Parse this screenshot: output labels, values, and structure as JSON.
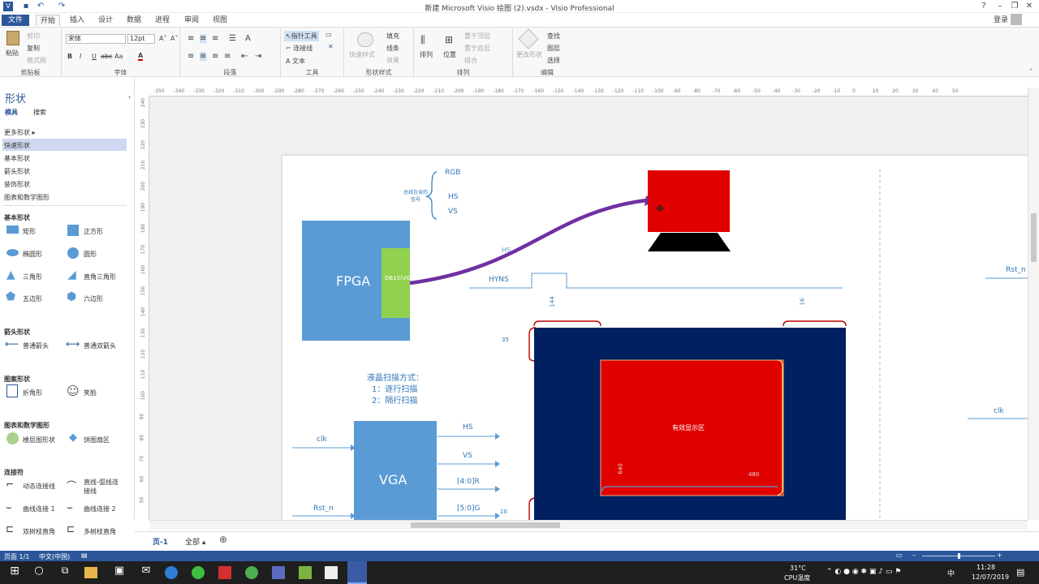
{
  "window": {
    "title": "新建 Microsoft Visio 绘图 (2).vsdx - Visio Professional",
    "help": "?"
  },
  "menu": {
    "file": "文件",
    "tabs": [
      "开始",
      "插入",
      "设计",
      "数据",
      "进程",
      "审阅",
      "视图"
    ],
    "login": "登录"
  },
  "ribbon": {
    "clipboard": {
      "paste": "粘贴",
      "cut": "剪切",
      "copy": "复制",
      "format_painter": "格式刷",
      "label": "剪贴板"
    },
    "font": {
      "name": "宋体",
      "size": "12pt",
      "bold": "B",
      "italic": "I",
      "underline": "U",
      "strike": "abc",
      "case": "Aa",
      "color": "A",
      "label": "字体"
    },
    "paragraph": {
      "label": "段落"
    },
    "tools": {
      "pointer": "指针工具",
      "connector": "连接线",
      "text": "文本",
      "label": "工具"
    },
    "shape_style": {
      "quick": "快速样式",
      "fill": "填充",
      "line": "线条",
      "effect": "效果",
      "label": "形状样式"
    },
    "arrange": {
      "align": "排列",
      "position": "位置",
      "front": "置于顶层",
      "back": "置于底层",
      "group": "组合",
      "label": "排列"
    },
    "edit": {
      "change": "更改形状",
      "find": "查找",
      "layer": "图层",
      "select": "选择",
      "label": "编辑"
    }
  },
  "shapes_panel": {
    "title": "形状",
    "tab_stencils": "模具",
    "tab_search": "搜索",
    "categories": [
      "更多形状",
      "快速形状",
      "基本形状",
      "箭头形状",
      "装饰形状",
      "图表和数学图形"
    ],
    "sec_basic": "基本形状",
    "basic": [
      "矩形",
      "正方形",
      "椭圆形",
      "圆形",
      "三角形",
      "直角三角形",
      "五边形",
      "六边形"
    ],
    "sec_arrow": "箭头形状",
    "arrows": [
      "普通箭头",
      "普通双箭头"
    ],
    "sec_deco": "图案形状",
    "deco": [
      "折角形",
      "笑脸"
    ],
    "sec_chart": "图表和数学图形",
    "chart": [
      "楼层图形状",
      "饼图扇区"
    ],
    "sec_conn": "连接符",
    "conn": [
      "动态连接线",
      "直线-弧线连接线",
      "曲线连接 1",
      "曲线连接 2",
      "双树枝直角",
      "多树枝直角"
    ]
  },
  "ruler": {
    "h": [
      "-350",
      "-340",
      "-330",
      "-320",
      "-310",
      "-300",
      "-290",
      "-280",
      "-270",
      "-260",
      "-250",
      "-240",
      "-230",
      "-220",
      "-210",
      "-200",
      "-190",
      "-180",
      "-170",
      "-160",
      "-150",
      "-140",
      "-130",
      "-120",
      "-110",
      "-100",
      "-90",
      "-80",
      "-70",
      "-60",
      "-50",
      "-40",
      "-30",
      "-20",
      "-10",
      "0",
      "10",
      "20",
      "30",
      "40",
      "50"
    ],
    "v": [
      "240",
      "230",
      "220",
      "210",
      "200",
      "190",
      "180",
      "170",
      "160",
      "150",
      "140",
      "130",
      "120",
      "110",
      "100",
      "90",
      "80",
      "70",
      "60",
      "50"
    ]
  },
  "diagram": {
    "rgb": "RGB",
    "hs": "HS",
    "vs": "VS",
    "bus_note": "总线包含的信号",
    "fpga": "FPGA",
    "db15": "DB15(VGA)",
    "hyns": "HYNS",
    "hs_small": "HS",
    "n144": "144",
    "n16": "16",
    "n35": "35",
    "n10": "10",
    "display_area": "有效显示区",
    "n640": "640",
    "n480": "480",
    "scan_title": "液晶扫描方式：",
    "scan1": "1：逐行扫描",
    "scan2": "2：隔行扫描",
    "clk": "clk",
    "rst": "Rst_n",
    "vga": "VGA",
    "out_hs": "HS",
    "out_vs": "VS",
    "out_r": "[4:0]R",
    "out_g": "[5:0]G",
    "rst_right": "Rst_n",
    "clk_right": "clk"
  },
  "pagetabs": {
    "page": "页-1",
    "all": "全部"
  },
  "status": {
    "page": "页面 1/1",
    "lang": "中文(中国)"
  },
  "taskbar": {
    "temp": "31°C",
    "temp_label": "CPU温度",
    "time": "11:28",
    "date": "12/07/2019",
    "ime": "中"
  },
  "colors": {
    "accent": "#2b579a",
    "fpga": "#5b9bd5",
    "green": "#92d050",
    "red": "#e00000",
    "navy": "#002060",
    "purple": "#7030a0"
  }
}
